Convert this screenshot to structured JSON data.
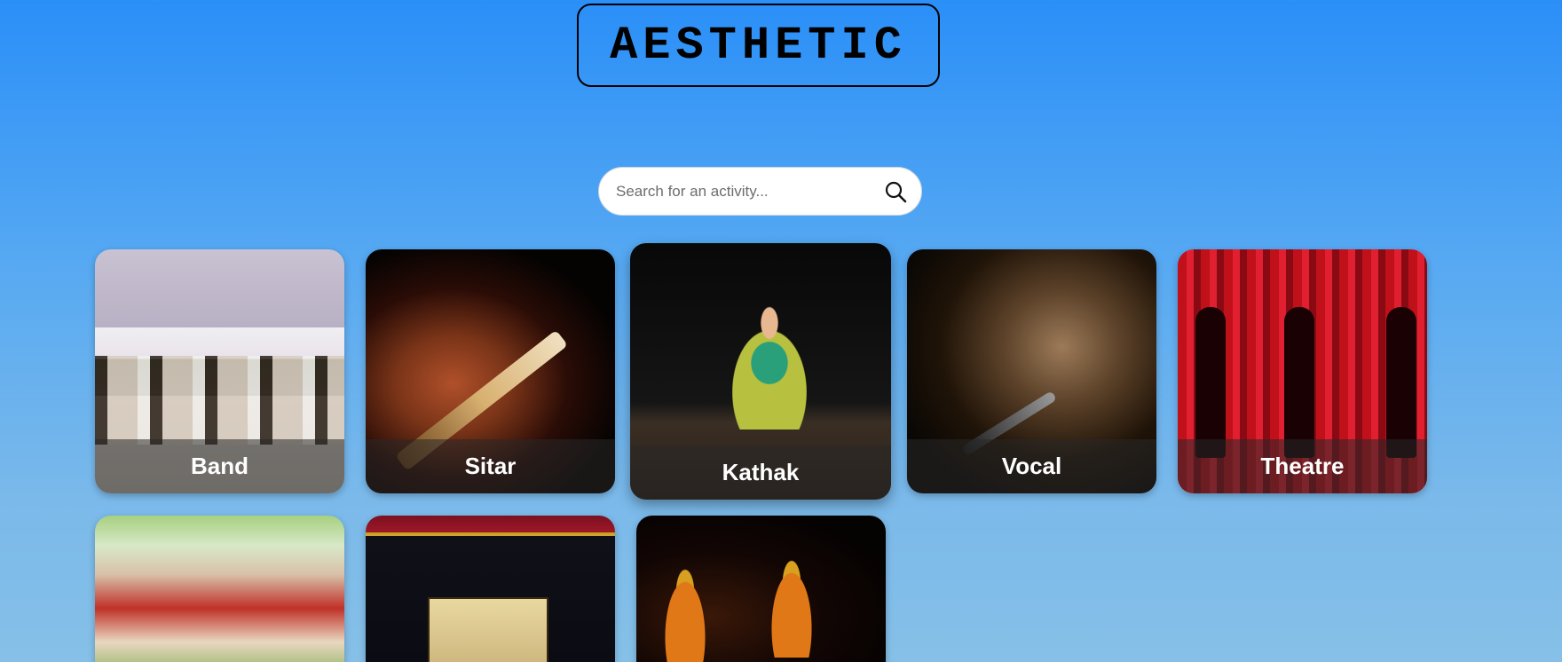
{
  "header": {
    "logo_text": "AESTHETIC"
  },
  "search": {
    "placeholder": "Search for an activity...",
    "value": "",
    "icon": "search-icon"
  },
  "activities": [
    {
      "label": "Band",
      "image": "band-photo"
    },
    {
      "label": "Sitar",
      "image": "sitar-photo"
    },
    {
      "label": "Kathak",
      "image": "kathak-photo"
    },
    {
      "label": "Vocal",
      "image": "vocal-photo"
    },
    {
      "label": "Theatre",
      "image": "theatre-photo"
    },
    {
      "label": "",
      "image": "folk-dance-photo"
    },
    {
      "label": "",
      "image": "orchestra-photo"
    },
    {
      "label": "",
      "image": "classical-dance-photo"
    }
  ],
  "colors": {
    "background_top": "#2a8ff8",
    "background_bottom": "#86c0e8",
    "card_label_bar": "rgba(40,40,40,0.55)",
    "card_label_text": "#ffffff"
  }
}
